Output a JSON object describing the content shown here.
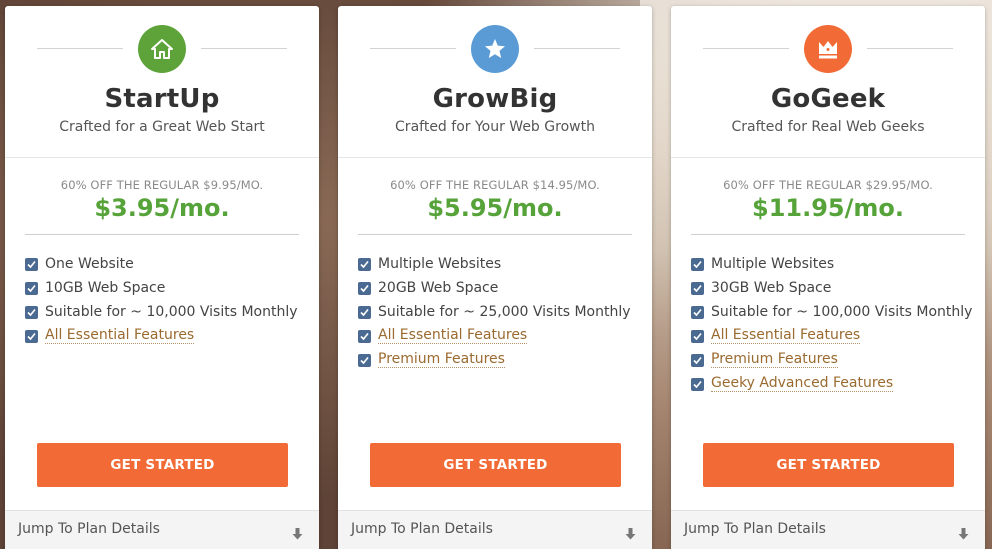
{
  "plans": [
    {
      "name": "StartUp",
      "tagline": "Crafted for a Great Web Start",
      "regular": "60% OFF THE REGULAR $9.95/MO.",
      "price": "$3.95/mo.",
      "icon": "home-icon",
      "icon_color": "#5ea33a",
      "features": [
        {
          "label": "One Website",
          "link": false
        },
        {
          "label": "10GB Web Space",
          "link": false
        },
        {
          "label": "Suitable for ~ 10,000 Visits Monthly",
          "link": false
        },
        {
          "label": "All Essential Features",
          "link": true
        }
      ],
      "cta": "GET STARTED",
      "jump": "Jump To Plan Details"
    },
    {
      "name": "GrowBig",
      "tagline": "Crafted for Your Web Growth",
      "regular": "60% OFF THE REGULAR $14.95/MO.",
      "price": "$5.95/mo.",
      "icon": "star-icon",
      "icon_color": "#5b9bd5",
      "features": [
        {
          "label": "Multiple Websites",
          "link": false
        },
        {
          "label": "20GB Web Space",
          "link": false
        },
        {
          "label": "Suitable for ~ 25,000 Visits Monthly",
          "link": false
        },
        {
          "label": "All Essential Features",
          "link": true
        },
        {
          "label": "Premium Features",
          "link": true
        }
      ],
      "cta": "GET STARTED",
      "jump": "Jump To Plan Details"
    },
    {
      "name": "GoGeek",
      "tagline": "Crafted for Real Web Geeks",
      "regular": "60% OFF THE REGULAR $29.95/MO.",
      "price": "$11.95/mo.",
      "icon": "crown-icon",
      "icon_color": "#f26a35",
      "features": [
        {
          "label": "Multiple Websites",
          "link": false
        },
        {
          "label": "30GB Web Space",
          "link": false
        },
        {
          "label": "Suitable for ~ 100,000 Visits Monthly",
          "link": false
        },
        {
          "label": "All Essential Features",
          "link": true
        },
        {
          "label": "Premium Features",
          "link": true
        },
        {
          "label": "Geeky Advanced Features",
          "link": true
        }
      ],
      "cta": "GET STARTED",
      "jump": "Jump To Plan Details"
    }
  ],
  "colors": {
    "price_green": "#56a33a",
    "cta_orange": "#f26a35",
    "check_blue": "#4a6a92",
    "link_brown": "#9a6a2f"
  }
}
